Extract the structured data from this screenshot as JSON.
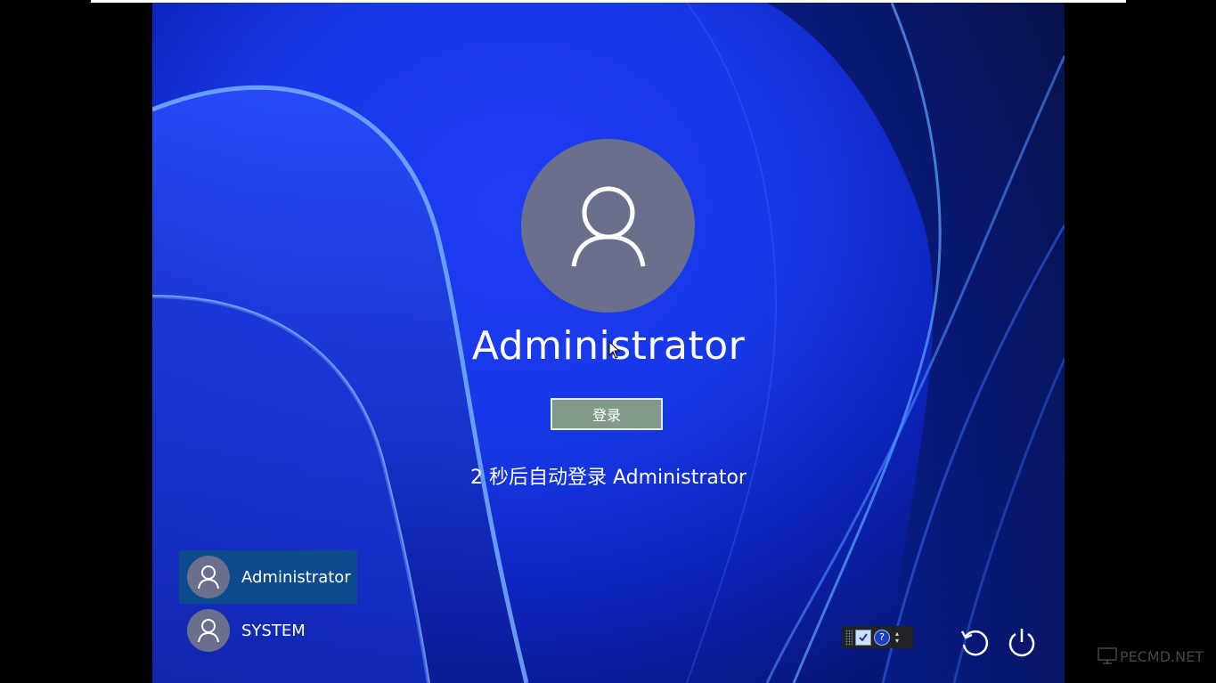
{
  "login": {
    "username": "Administrator",
    "login_button": "登录",
    "autologin_text": "2 秒后自动登录 Administrator"
  },
  "users": [
    {
      "name": "Administrator",
      "selected": true
    },
    {
      "name": "SYSTEM",
      "selected": false
    }
  ],
  "tray": {
    "icons": [
      "grip-icon",
      "check-window-icon",
      "help-icon",
      "scroll-arrows-icon"
    ]
  },
  "controls": {
    "restart_icon": "restart-icon",
    "power_icon": "power-icon"
  },
  "watermark": {
    "text": "PECMD.NET"
  },
  "colors": {
    "background_blue": "#1638e6",
    "avatar": "#6a6f8c",
    "login_button": "#829a8a",
    "selected_user": "#0a5082"
  }
}
